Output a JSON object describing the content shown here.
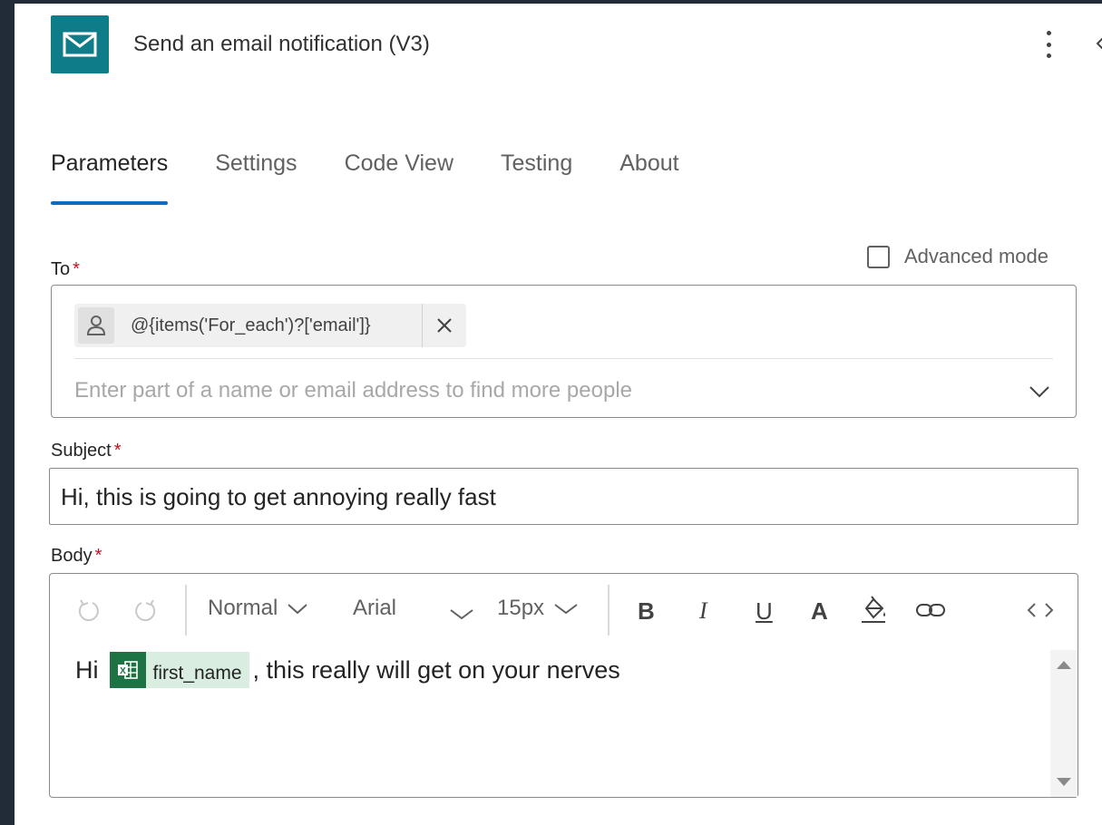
{
  "header": {
    "title": "Send an email notification (V3)",
    "icon": "mail-icon",
    "accent": "#0f7c8a"
  },
  "tabs": [
    {
      "label": "Parameters",
      "active": true
    },
    {
      "label": "Settings",
      "active": false
    },
    {
      "label": "Code View",
      "active": false
    },
    {
      "label": "Testing",
      "active": false
    },
    {
      "label": "About",
      "active": false
    }
  ],
  "fields": {
    "to": {
      "label": "To",
      "required_mark": "*",
      "token_text": "@{items('For_each')?['email']}",
      "placeholder": "Enter part of a name or email address to find more people"
    },
    "advanced_mode": {
      "label": "Advanced mode",
      "checked": false
    },
    "subject": {
      "label": "Subject",
      "required_mark": "*",
      "value": "Hi, this is going to get annoying really fast"
    },
    "body": {
      "label": "Body",
      "required_mark": "*",
      "toolbar": {
        "style": "Normal",
        "font": "Arial",
        "size": "15px",
        "bold": "B",
        "italic": "I",
        "underline": "U",
        "font_color": "A"
      },
      "content_before": "Hi",
      "dynamic_token": "first_name",
      "content_after": ", this really will get on your nerves"
    }
  },
  "colors": {
    "tab_indicator": "#0f6cbd",
    "required": "#c50f1f",
    "excel_green": "#1d7343",
    "background": "#222b38"
  }
}
